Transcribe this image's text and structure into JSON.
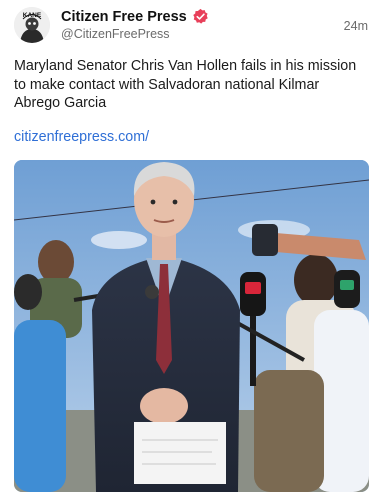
{
  "post": {
    "author": {
      "display_name": "Citizen Free Press",
      "handle": "@CitizenFreePress",
      "avatar_text": "KANE",
      "verified": true
    },
    "timestamp": "24m",
    "text": "Maryland Senator Chris Van Hollen fails in his mission to make contact with Salvadoran national Kilmar Abrego Garcia",
    "link_text": "citizenfreepress.com/",
    "media": {
      "type": "photo",
      "description_icon": "press-conference-photo"
    }
  },
  "colors": {
    "verified_badge": "#e8405a",
    "link": "#2f6fd6",
    "handle_gray": "#6b6b6b"
  }
}
